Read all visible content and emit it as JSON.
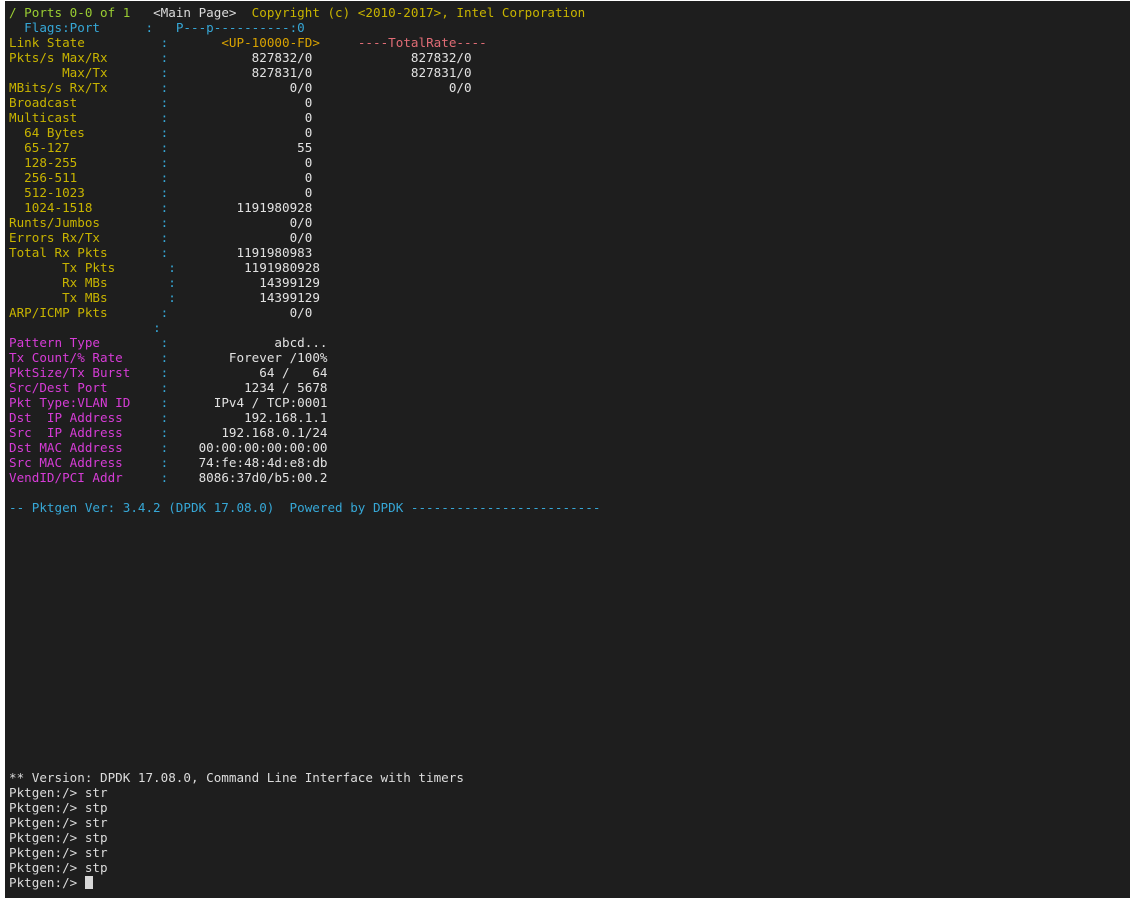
{
  "header": {
    "ports": "/ Ports 0-0 of 1",
    "page": "<Main Page>",
    "copyright": "Copyright (c) <2010-2017>, Intel Corporation"
  },
  "flags": {
    "label": "Flags:Port",
    "value": "P---p----------:0"
  },
  "link": {
    "label": "Link State",
    "value": "<UP-10000-FD>",
    "total_title": "----TotalRate----"
  },
  "stats": [
    {
      "label": "Pkts/s Max/Rx",
      "value": "827832/0",
      "total": "827832/0"
    },
    {
      "label": "Max/Tx",
      "value": "827831/0",
      "total": "827831/0"
    },
    {
      "label": "MBits/s Rx/Tx",
      "value": "0/0",
      "total": "0/0"
    },
    {
      "label": "Broadcast",
      "value": "0"
    },
    {
      "label": "Multicast",
      "value": "0"
    },
    {
      "label": "64 Bytes",
      "value": "0"
    },
    {
      "label": "65-127",
      "value": "55"
    },
    {
      "label": "128-255",
      "value": "0"
    },
    {
      "label": "256-511",
      "value": "0"
    },
    {
      "label": "512-1023",
      "value": "0"
    },
    {
      "label": "1024-1518",
      "value": "1191980928"
    },
    {
      "label": "Runts/Jumbos",
      "value": "0/0"
    },
    {
      "label": "Errors Rx/Tx",
      "value": "0/0"
    },
    {
      "label": "Total Rx Pkts",
      "value": "1191980983"
    },
    {
      "label": "Tx Pkts",
      "value": "1191980928"
    },
    {
      "label": "Rx MBs",
      "value": "14399129"
    },
    {
      "label": "Tx MBs",
      "value": "14399129"
    },
    {
      "label": "ARP/ICMP Pkts",
      "value": "0/0"
    }
  ],
  "config": [
    {
      "label": "Pattern Type",
      "value": "abcd..."
    },
    {
      "label": "Tx Count/% Rate",
      "value": "Forever /100%"
    },
    {
      "label": "PktSize/Tx Burst",
      "value": "64 /   64"
    },
    {
      "label": "Src/Dest Port",
      "value": "1234 / 5678"
    },
    {
      "label": "Pkt Type:VLAN ID",
      "value": "IPv4 / TCP:0001"
    },
    {
      "label": "Dst  IP Address",
      "value": "192.168.1.1"
    },
    {
      "label": "Src  IP Address",
      "value": "192.168.0.1/24"
    },
    {
      "label": "Dst MAC Address",
      "value": "00:00:00:00:00:00"
    },
    {
      "label": "Src MAC Address",
      "value": "74:fe:48:4d:e8:db"
    },
    {
      "label": "VendID/PCI Addr",
      "value": "8086:37d0/b5:00.2"
    }
  ],
  "footer": {
    "version": "-- Pktgen Ver: 3.4.2 (DPDK 17.08.0)",
    "powered": "Powered by DPDK",
    "dashes": "-------------------------"
  },
  "cli": {
    "banner": "** Version: DPDK 17.08.0, Command Line Interface with timers",
    "prompt": "Pktgen:/> ",
    "history": [
      "str",
      "stp",
      "str",
      "stp",
      "str",
      "stp"
    ]
  },
  "colors": {
    "background": "#1e1e1e",
    "header_green": "#9acd32",
    "label_yellow": "#c8b400",
    "accent_cyan": "#36a7d6",
    "total_red": "#e06c75",
    "config_magenta": "#d63cd6"
  }
}
